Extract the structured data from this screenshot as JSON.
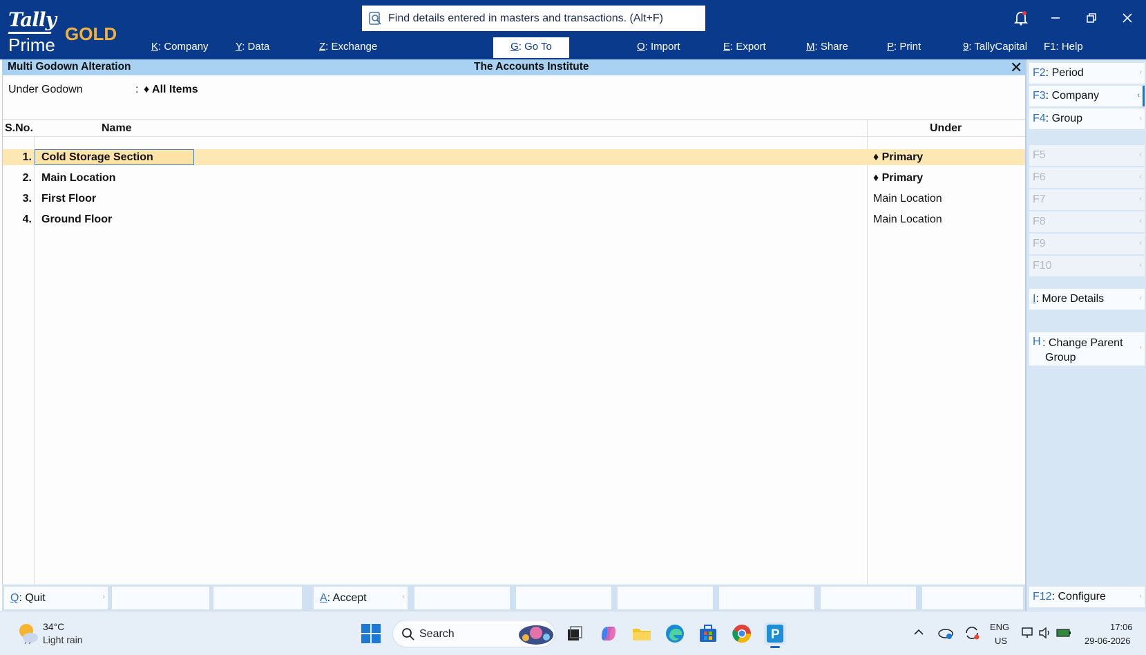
{
  "app": {
    "brand_top": "Tally",
    "brand_bottom": "Prime",
    "edition": "GOLD",
    "search_placeholder": "Find details entered in masters and transactions. (Alt+F)"
  },
  "topmenu": [
    {
      "key": "K",
      "label": ": Company"
    },
    {
      "key": "Y",
      "label": ": Data"
    },
    {
      "key": "Z",
      "label": ": Exchange"
    },
    {
      "key": "G",
      "label": ": Go To"
    },
    {
      "key": "O",
      "label": ": Import"
    },
    {
      "key": "E",
      "label": ": Export"
    },
    {
      "key": "M",
      "label": ": Share"
    },
    {
      "key": "P",
      "label": ": Print"
    },
    {
      "key": "9",
      "label": ": TallyCapital"
    },
    {
      "key": "F1",
      "label": ": Help"
    }
  ],
  "screen": {
    "title": "Multi Godown Alteration",
    "company": "The Accounts Institute",
    "under_label": "Under Godown",
    "under_colon": ":",
    "under_value": "♦ All Items"
  },
  "table": {
    "headers": {
      "sno": "S.No.",
      "name": "Name",
      "under": "Under"
    },
    "rows": [
      {
        "sno": "1.",
        "name": "Cold Storage Section",
        "under": "♦ Primary"
      },
      {
        "sno": "2.",
        "name": "Main Location",
        "under": "♦ Primary"
      },
      {
        "sno": "3.",
        "name": "First Floor",
        "under": "Main Location"
      },
      {
        "sno": "4.",
        "name": "Ground Floor",
        "under": "Main Location"
      }
    ]
  },
  "bottom_buttons": [
    {
      "key": "Q",
      "label": ": Quit"
    },
    {
      "key": "A",
      "label": ": Accept"
    }
  ],
  "right_buttons": {
    "period": {
      "key": "F2",
      "label": ": Period"
    },
    "company": {
      "key": "F3",
      "label": ": Company"
    },
    "group": {
      "key": "F4",
      "label": ": Group"
    },
    "f5": "F5",
    "f6": "F6",
    "f7": "F7",
    "f8": "F8",
    "f9": "F9",
    "f10": "F10",
    "more_details": {
      "key": "I",
      "label": ": More Details"
    },
    "change_parent": {
      "key": "H",
      "label": ": Change Parent",
      "label2": "Group"
    },
    "configure": {
      "key": "F12",
      "label": ": Configure"
    }
  },
  "taskbar": {
    "temperature": "34°C",
    "weather": "Light rain",
    "search_label": "Search",
    "lang_top": "ENG",
    "lang_bottom": "US",
    "time": "17:06",
    "date": "29-06-2026"
  },
  "colors": {
    "topbar": "#0a3a8c",
    "gold": "#f2b33d",
    "titlebar": "#a9d2f2",
    "selected_row": "#fde8b4",
    "key_blue": "#2a6fc0"
  }
}
